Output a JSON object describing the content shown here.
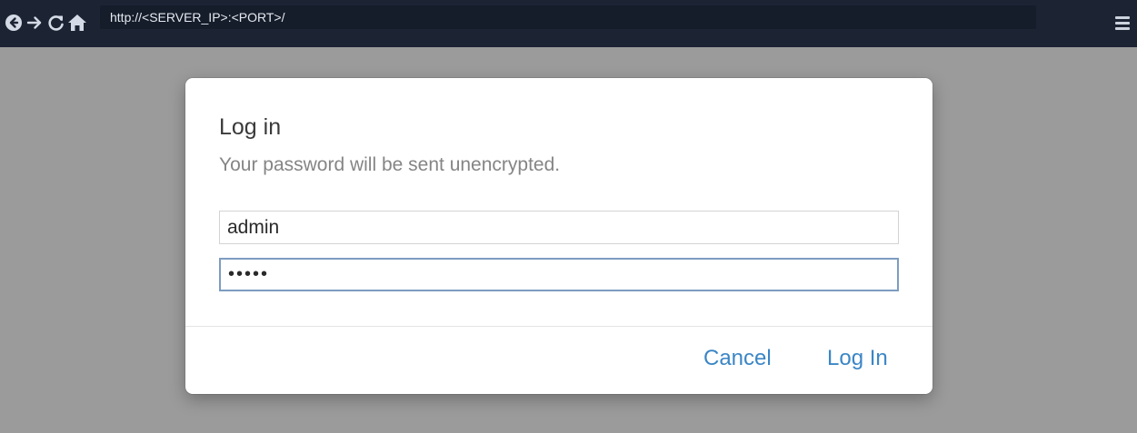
{
  "browser": {
    "url": "http://<SERVER_IP>:<PORT>/",
    "icons": {
      "back": "back-circle-icon",
      "forward": "arrow-right-icon",
      "reload": "reload-icon",
      "home": "home-icon",
      "menu": "hamburger-menu-icon"
    }
  },
  "dialog": {
    "title": "Log in",
    "subtitle": "Your password will be sent unencrypted.",
    "username_value": "admin",
    "password_value": "12345",
    "cancel_label": "Cancel",
    "login_label": "Log In"
  },
  "colors": {
    "toolbar": "#1c2434",
    "overlay": "#9b9b9b",
    "accent": "#3b86c6",
    "focus_border": "#7d9cc0"
  }
}
